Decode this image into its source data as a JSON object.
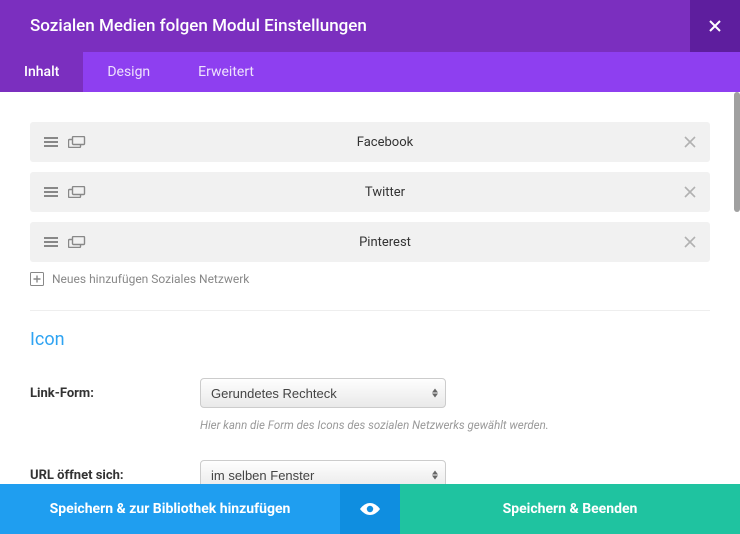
{
  "header": {
    "title": "Sozialen Medien folgen Modul Einstellungen"
  },
  "tabs": [
    {
      "label": "Inhalt",
      "active": true
    },
    {
      "label": "Design",
      "active": false
    },
    {
      "label": "Erweitert",
      "active": false
    }
  ],
  "networks": [
    {
      "label": "Facebook"
    },
    {
      "label": "Twitter"
    },
    {
      "label": "Pinterest"
    }
  ],
  "add_new": "Neues hinzufügen Soziales Netzwerk",
  "section_icon": {
    "title": "Icon"
  },
  "fields": {
    "link_form": {
      "label": "Link-Form:",
      "value": "Gerundetes Rechteck",
      "hint": "Hier kann die Form des Icons des sozialen Netzwerks gewählt werden."
    },
    "url_opens": {
      "label": "URL öffnet sich:",
      "value": "im selben Fenster"
    }
  },
  "footer": {
    "save_library": "Speichern & zur Bibliothek hinzufügen",
    "save_exit": "Speichern & Beenden"
  }
}
